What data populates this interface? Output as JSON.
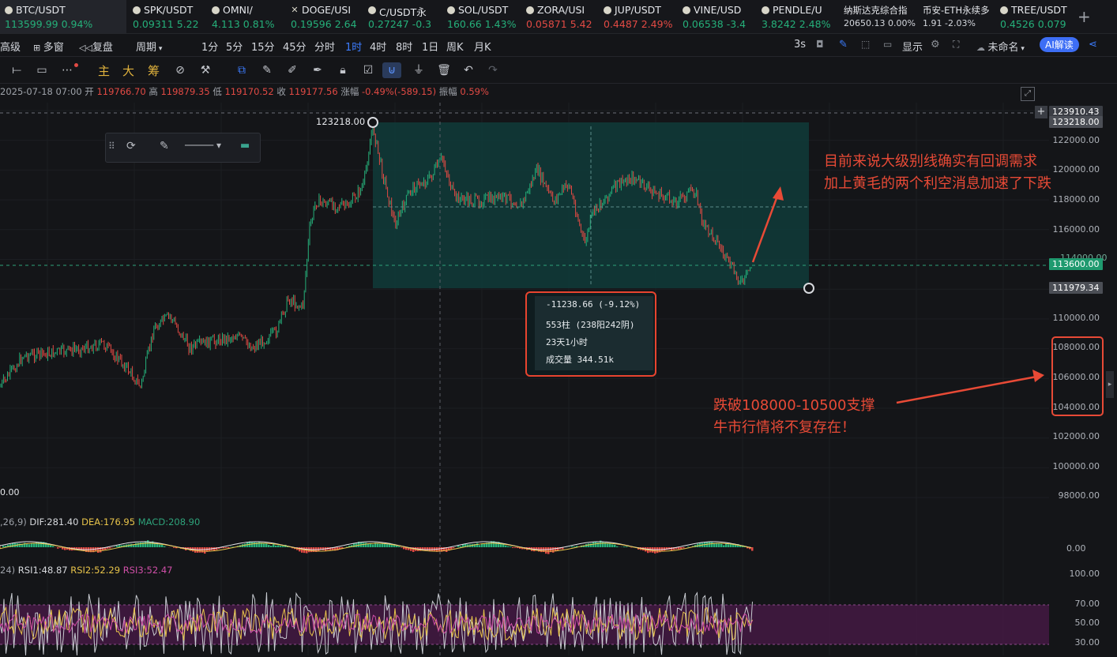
{
  "tickers": [
    {
      "name": "BTC/USDT",
      "price": "113599.99",
      "chg": "0.94%",
      "dir": "up",
      "icon": "bitcoin-icon"
    },
    {
      "name": "SPK/USDT",
      "price": "0.09311",
      "chg": "5.22",
      "dir": "up",
      "icon": "coin-icon"
    },
    {
      "name": "OMNI/",
      "price": "4.113",
      "chg": "0.81%",
      "dir": "up",
      "icon": "coin-icon"
    },
    {
      "name": "DOGE/USI",
      "price": "0.19596",
      "chg": "2.64",
      "dir": "up",
      "icon": "close-icon"
    },
    {
      "name": "C/USDT永",
      "price": "0.27247",
      "chg": "-0.3",
      "dir": "up",
      "icon": "coin-icon"
    },
    {
      "name": "SOL/USDT",
      "price": "160.66",
      "chg": "1.43%",
      "dir": "up",
      "icon": "coin-icon"
    },
    {
      "name": "ZORA/USI",
      "price": "0.05871",
      "chg": "5.42",
      "dir": "dn",
      "icon": "coin-icon"
    },
    {
      "name": "JUP/USDT",
      "price": "0.4487",
      "chg": "2.49%",
      "dir": "dn",
      "icon": "coin-icon"
    },
    {
      "name": "VINE/USD",
      "price": "0.06538",
      "chg": "-3.4",
      "dir": "up",
      "icon": "coin-icon"
    },
    {
      "name": "PENDLE/U",
      "price": "3.8242",
      "chg": "2.48%",
      "dir": "up",
      "icon": "coin-icon"
    },
    {
      "name": "纳斯达克综合指",
      "price": "20650.13",
      "chg": "0.00%",
      "dir": "flat",
      "icon": ""
    },
    {
      "name": "币安-ETH永续多",
      "price": "1.91",
      "chg": "-2.03%",
      "dir": "flat",
      "icon": ""
    },
    {
      "name": "TREE/USDT",
      "price": "0.4526",
      "chg": "0.079",
      "dir": "up",
      "icon": "coin-icon"
    }
  ],
  "toolbar1": {
    "items": [
      "高级",
      "多窗",
      "复盘",
      "周期",
      "1分",
      "5分",
      "15分",
      "45分",
      "分时",
      "1时",
      "4时",
      "8时",
      "1日",
      "周K",
      "月K"
    ],
    "selected": "1时",
    "refresh": "3s",
    "display": "显示",
    "layout_name": "未命名",
    "ai_button": "AI解读"
  },
  "toolbar2": {
    "chars": [
      "主",
      "大",
      "筹"
    ]
  },
  "ohlc": {
    "date": "2025-07-18 07:00",
    "open_label": "开",
    "open": "119766.70",
    "high_label": "高",
    "high": "119879.35",
    "low_label": "低",
    "low": "119170.52",
    "close_label": "收",
    "close": "119177.56",
    "chg_label": "涨幅",
    "chg": "-0.49%(-589.15)",
    "amp_label": "振幅",
    "amp": "0.59%"
  },
  "price_axis": [
    "122000.00",
    "120000.00",
    "118000.00",
    "116000.00",
    "110000.00",
    "108000.00",
    "106000.00",
    "104000.00",
    "102000.00",
    "100000.00",
    "98000.00"
  ],
  "price_tags": {
    "top": "123910.43",
    "high": "123218.00",
    "current": "113600.00",
    "low": "111979.34",
    "partial": "114000.00"
  },
  "peak_label": "123218.00",
  "left_partial": "0.00",
  "measure": {
    "change": "-11238.66 (-9.12%)",
    "bars": "553柱 (238阳242阴)",
    "duration": "23天1小时",
    "volume": "成交量 344.51k"
  },
  "annotations": {
    "top_line1": "目前来说大级别线确实有回调需求",
    "top_line2": "加上黄毛的两个利空消息加速了下跌",
    "bottom_line1": "跌破108000-10500支撑",
    "bottom_line2": "牛市行情将不复存在！"
  },
  "macd": {
    "params": ",26,9)",
    "dif": "DIF:281.40",
    "dea": "DEA:176.95",
    "macd": "MACD:208.90",
    "axis": "0.00"
  },
  "rsi": {
    "params": "24)",
    "rsi1": "RSI1:48.87",
    "rsi2": "RSI2:52.29",
    "rsi3": "RSI3:52.47",
    "axis": [
      "100.00",
      "70.00",
      "50.00",
      "30.00"
    ]
  },
  "colors": {
    "up": "#25b07a",
    "down": "#e24a44",
    "accent": "#3d7dff",
    "annotation": "#e84a36",
    "box": "#0f3b3a"
  }
}
